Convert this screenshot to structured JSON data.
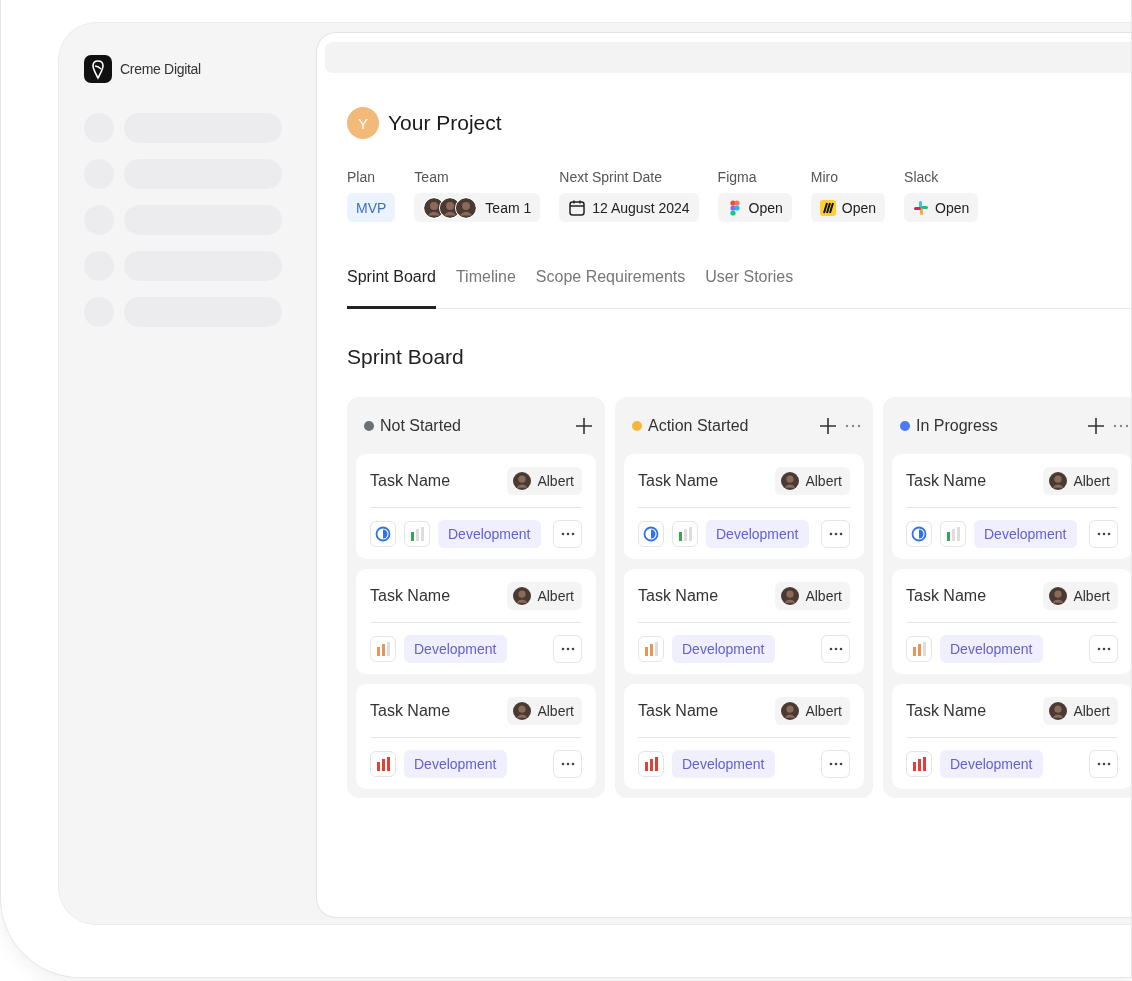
{
  "brand": {
    "name": "Creme Digital"
  },
  "project": {
    "initial": "Y",
    "title": "Your Project"
  },
  "meta": [
    {
      "kind": "badge",
      "label": "Plan",
      "value": "MVP"
    },
    {
      "kind": "team",
      "label": "Team",
      "value": "Team 1"
    },
    {
      "kind": "date",
      "label": "Next Sprint Date",
      "value": "12 August 2024"
    },
    {
      "kind": "link",
      "label": "Figma",
      "value": "Open"
    },
    {
      "kind": "link",
      "label": "Miro",
      "value": "Open"
    },
    {
      "kind": "link",
      "label": "Slack",
      "value": "Open"
    }
  ],
  "tabs": [
    {
      "label": "Sprint Board",
      "selected": true
    },
    {
      "label": "Timeline",
      "selected": false
    },
    {
      "label": "Scope Requirements",
      "selected": false
    },
    {
      "label": "User Stories",
      "selected": false
    }
  ],
  "board": {
    "title": "Sprint Board",
    "columns": [
      {
        "title": "Not Started",
        "color": "#6b7075",
        "menu": false,
        "cards": [
          {
            "name": "Task Name",
            "assignee": "Albert",
            "half_done": true,
            "priority": {
              "kind": "low",
              "color": "#3aa655"
            },
            "tag": "Development"
          },
          {
            "name": "Task Name",
            "assignee": "Albert",
            "half_done": false,
            "priority": {
              "kind": "medium",
              "color": "#e8955a"
            },
            "tag": "Development"
          },
          {
            "name": "Task Name",
            "assignee": "Albert",
            "half_done": false,
            "priority": {
              "kind": "high",
              "color": "#e0403a"
            },
            "tag": "Development"
          }
        ]
      },
      {
        "title": "Action Started",
        "color": "#f5b73b",
        "menu": true,
        "cards": [
          {
            "name": "Task Name",
            "assignee": "Albert",
            "half_done": true,
            "priority": {
              "kind": "low",
              "color": "#3aa655"
            },
            "tag": "Development"
          },
          {
            "name": "Task Name",
            "assignee": "Albert",
            "half_done": false,
            "priority": {
              "kind": "medium",
              "color": "#e8955a"
            },
            "tag": "Development"
          },
          {
            "name": "Task Name",
            "assignee": "Albert",
            "half_done": false,
            "priority": {
              "kind": "high",
              "color": "#e0403a"
            },
            "tag": "Development"
          }
        ]
      },
      {
        "title": "In Progress",
        "color": "#4a7bf0",
        "menu": true,
        "cards": [
          {
            "name": "Task Name",
            "assignee": "Albert",
            "half_done": true,
            "priority": {
              "kind": "low",
              "color": "#3aa655"
            },
            "tag": "Development"
          },
          {
            "name": "Task Name",
            "assignee": "Albert",
            "half_done": false,
            "priority": {
              "kind": "medium",
              "color": "#e8955a"
            },
            "tag": "Development"
          },
          {
            "name": "Task Name",
            "assignee": "Albert",
            "half_done": false,
            "priority": {
              "kind": "high",
              "color": "#e0403a"
            },
            "tag": "Development"
          }
        ]
      }
    ]
  }
}
